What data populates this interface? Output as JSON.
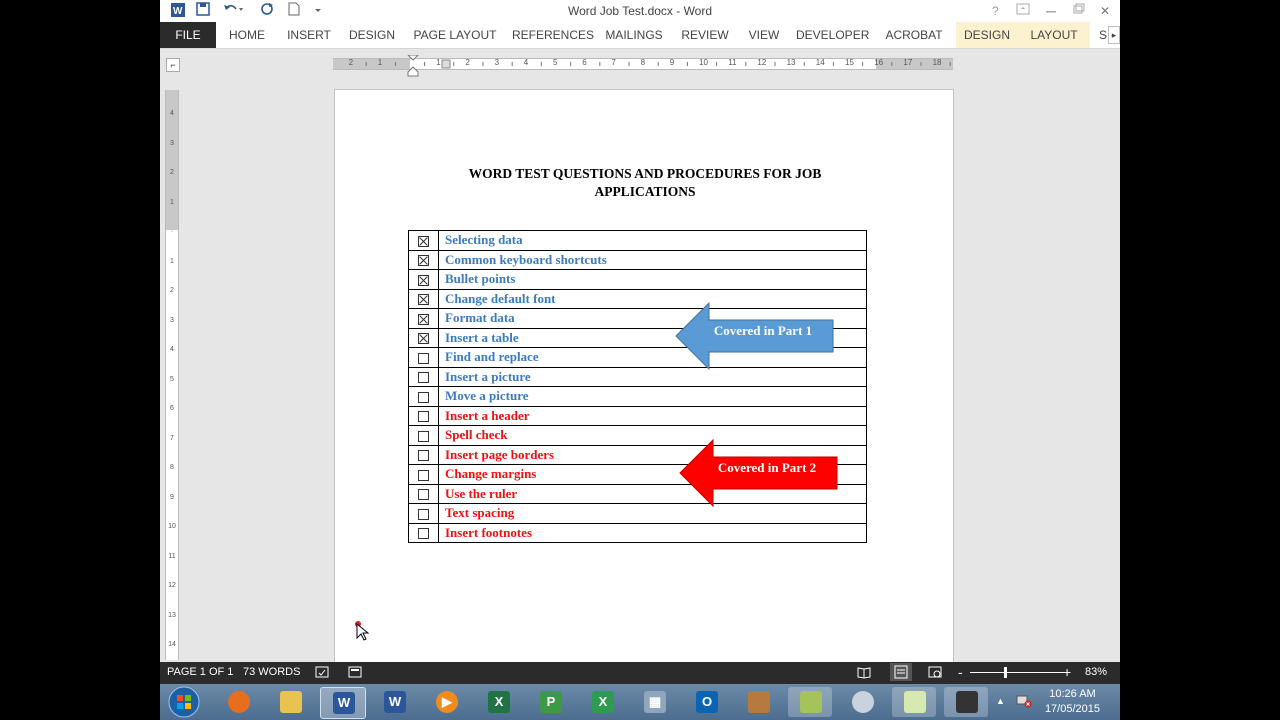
{
  "window": {
    "title": "Word Job Test.docx - Word",
    "help": "?",
    "close": "✕"
  },
  "ribbon": {
    "tabs": [
      "FILE",
      "HOME",
      "INSERT",
      "DESIGN",
      "PAGE LAYOUT",
      "REFERENCES",
      "MAILINGS",
      "REVIEW",
      "VIEW",
      "DEVELOPER",
      "ACROBAT",
      "DESIGN",
      "LAYOUT",
      "S"
    ]
  },
  "document": {
    "heading_line1": "WORD TEST QUESTIONS AND PROCEDURES FOR JOB",
    "heading_line2": "APPLICATIONS",
    "items": [
      {
        "label": "Selecting data",
        "checked": true,
        "color": "#3b7bbf"
      },
      {
        "label": "Common keyboard shortcuts",
        "checked": true,
        "color": "#3b7bbf"
      },
      {
        "label": "Bullet points",
        "checked": true,
        "color": "#3b7bbf"
      },
      {
        "label": "Change default font",
        "checked": true,
        "color": "#3b7bbf"
      },
      {
        "label": "Format data",
        "checked": true,
        "color": "#3b7bbf"
      },
      {
        "label": "Insert a table",
        "checked": true,
        "color": "#3b7bbf"
      },
      {
        "label": "Find and replace",
        "checked": false,
        "color": "#3b7bbf"
      },
      {
        "label": "Insert a picture",
        "checked": false,
        "color": "#3b7bbf"
      },
      {
        "label": "Move a picture",
        "checked": false,
        "color": "#3b7bbf"
      },
      {
        "label": "Insert a header",
        "checked": false,
        "color": "#ee1111"
      },
      {
        "label": "Spell check",
        "checked": false,
        "color": "#ee1111"
      },
      {
        "label": "Insert page borders",
        "checked": false,
        "color": "#ee1111"
      },
      {
        "label": "Change margins",
        "checked": false,
        "color": "#ee1111"
      },
      {
        "label": "Use the ruler",
        "checked": false,
        "color": "#ee1111"
      },
      {
        "label": "Text spacing",
        "checked": false,
        "color": "#ee1111"
      },
      {
        "label": "Insert footnotes",
        "checked": false,
        "color": "#ee1111"
      }
    ],
    "callout1": "Covered in Part 1",
    "callout2": "Covered in Part 2"
  },
  "status": {
    "page": "PAGE 1 OF 1",
    "words": "73 WORDS",
    "zoom": "83%",
    "zoom_minus": "-",
    "zoom_plus": "+"
  },
  "taskbar": {
    "time": "10:26 AM",
    "date": "17/05/2015"
  },
  "colors": {
    "part1": "#5b9bd5",
    "part2": "#ff0000"
  }
}
